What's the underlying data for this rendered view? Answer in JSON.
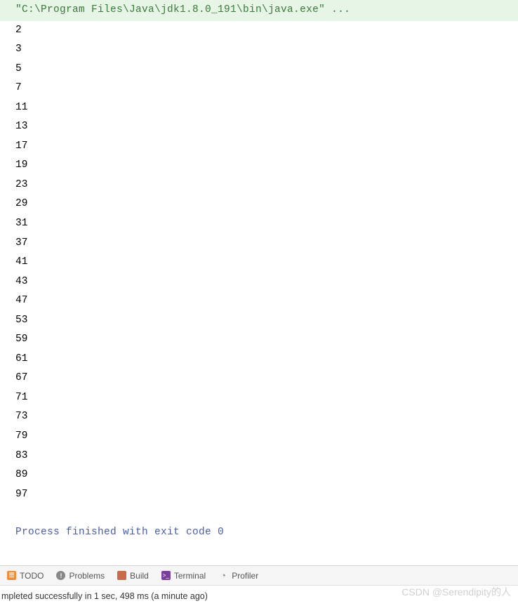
{
  "console": {
    "command": "\"C:\\Program Files\\Java\\jdk1.8.0_191\\bin\\java.exe\" ...",
    "output_lines": [
      "2",
      "3",
      "5",
      "7",
      "11",
      "13",
      "17",
      "19",
      "23",
      "29",
      "31",
      "37",
      "41",
      "43",
      "47",
      "53",
      "59",
      "61",
      "67",
      "71",
      "73",
      "79",
      "83",
      "89",
      "97"
    ],
    "exit_message": "Process finished with exit code 0"
  },
  "tabs": {
    "todo": "TODO",
    "problems": "Problems",
    "build": "Build",
    "terminal": "Terminal",
    "profiler": "Profiler"
  },
  "status": {
    "message": "mpleted successfully in 1 sec, 498 ms (a minute ago)"
  },
  "watermark": "CSDN @Serendipity的人"
}
